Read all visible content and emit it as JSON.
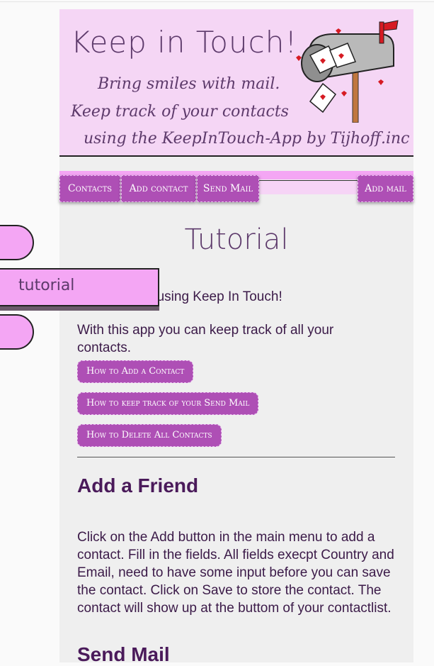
{
  "header": {
    "title": "Keep in Touch!",
    "tagline_1": "Bring smiles with mail.",
    "tagline_2": "Keep track of your contacts",
    "tagline_3": "using the KeepInTouch-App by Tijhoff.inc"
  },
  "nav": {
    "contacts": "Contacts",
    "add_contact": "Add contact",
    "send_mail": "Send Mail",
    "add_mail": "Add mail"
  },
  "side": {
    "tab_label": "tutorial"
  },
  "tutorial": {
    "title": "Tutorial",
    "intro_1": "r using Keep In Touch!",
    "intro_2": "With this app you can keep track of all your contacts.",
    "buttons": [
      "How to Add a Contact",
      "How to keep track of your Send Mail",
      "How to Delete All Contacts"
    ],
    "sections": [
      {
        "title": "Add a Friend",
        "text": "Click on the Add button in the main menu to add a contact. Fill in the fields. All fields execpt Country and Email, need to have some input before you can save the contact. Click on Save to store the contact. The contact will show up at the buttom of your contactlist."
      },
      {
        "title": "Send Mail"
      }
    ]
  },
  "colors": {
    "accent": "#ae4fb5",
    "header_bg": "#f5d6f5",
    "pink": "#f4a6f4",
    "text": "#3b1a48"
  }
}
